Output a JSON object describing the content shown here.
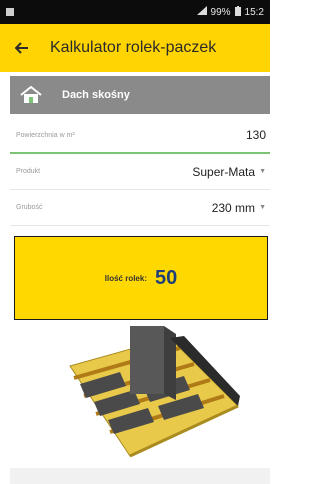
{
  "status_bar": {
    "battery_text": "99%",
    "time": "15:2"
  },
  "app_bar": {
    "title": "Kalkulator rolek-paczek"
  },
  "section": {
    "label": "Dach skośny"
  },
  "fields": [
    {
      "label": "Powierzchnia w m²",
      "value": "130"
    },
    {
      "label": "Produkt",
      "value": "Super-Mata"
    },
    {
      "label": "Grubość",
      "value": "230 mm"
    }
  ],
  "result": {
    "label": "Ilość rolek:",
    "value": "50"
  },
  "colors": {
    "brand_yellow": "#ffd400",
    "accent_green": "#7cc576",
    "result_blue": "#1f3f7a"
  }
}
